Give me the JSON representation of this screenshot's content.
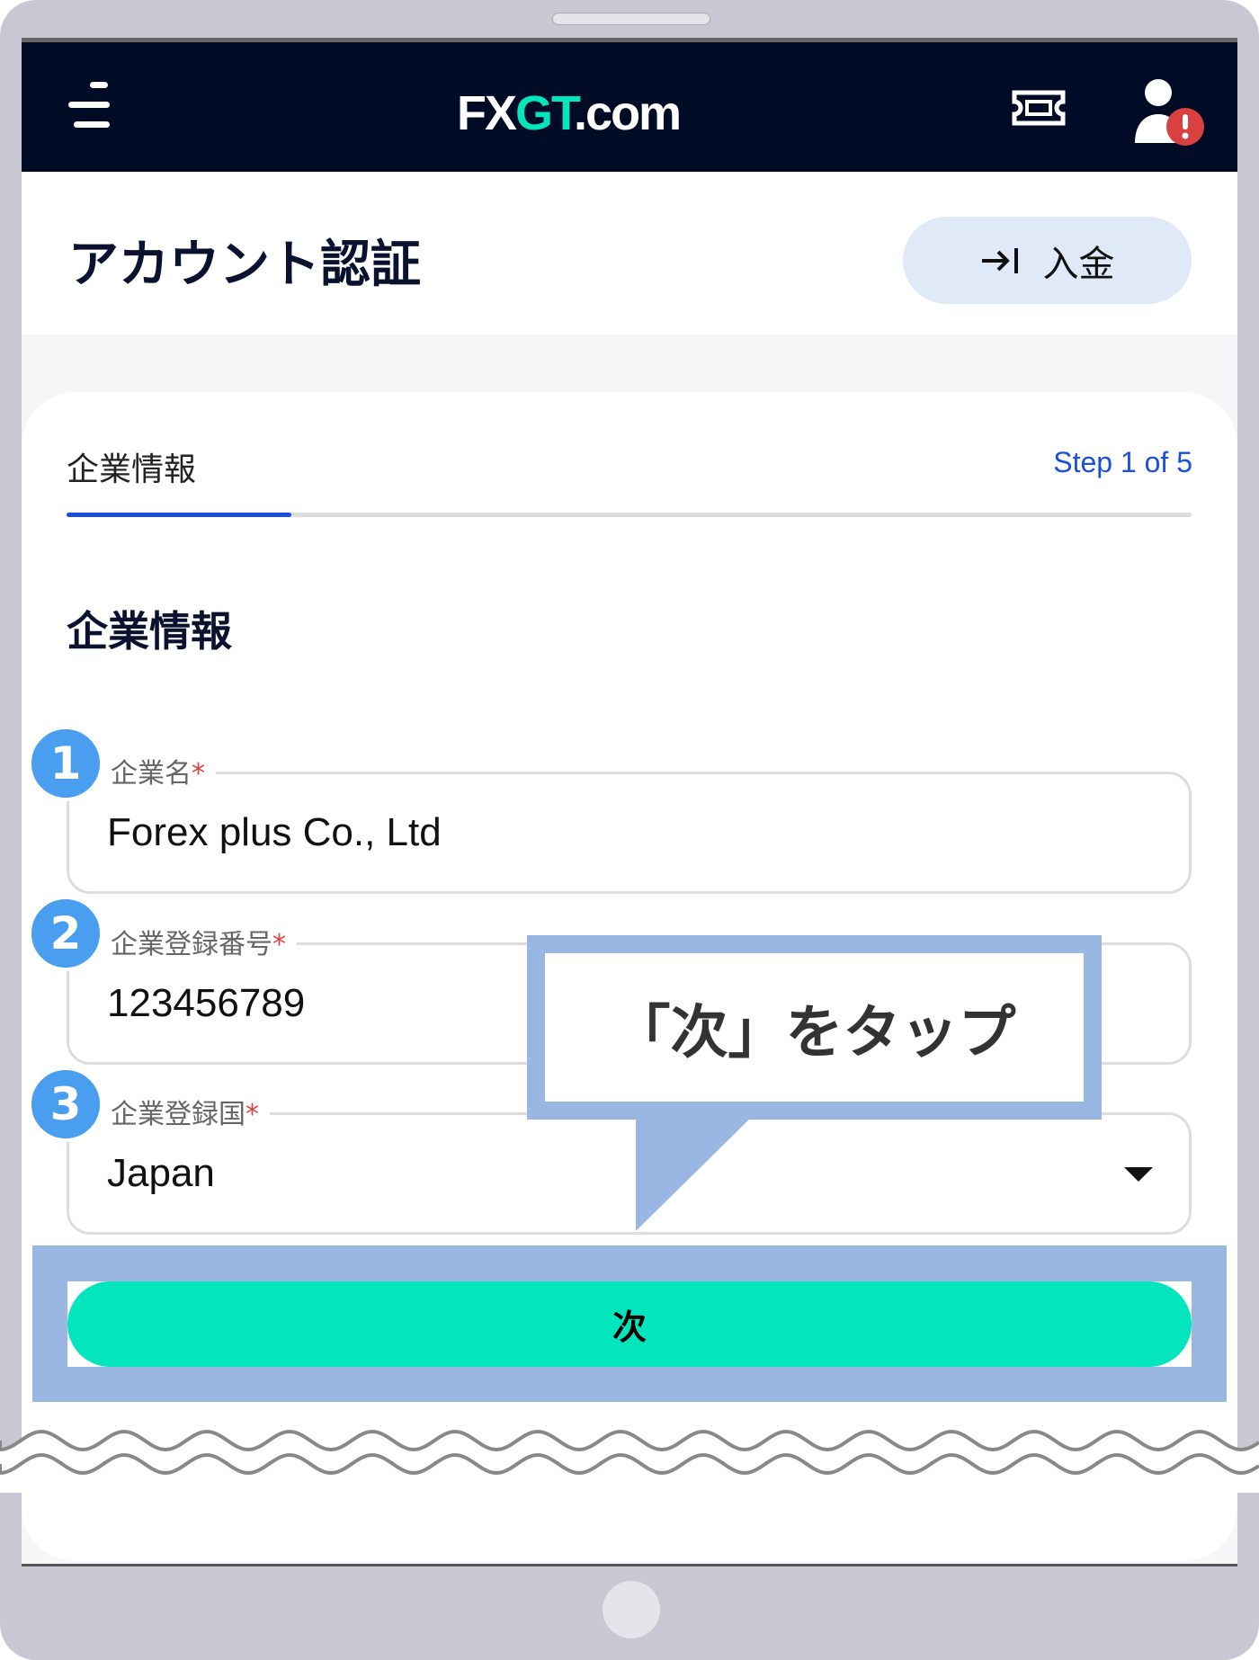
{
  "header": {
    "logo": {
      "part1": "FX",
      "part2": "GT",
      ".com": ".com"
    },
    "logo_text_a": "FX",
    "logo_text_b": "GT",
    "logo_text_c": ".com",
    "icons": [
      "menu-icon",
      "ticket-icon",
      "user-alert-icon"
    ]
  },
  "titlebar": {
    "title": "アカウント認証",
    "deposit_label": "入金",
    "deposit_icon": "arrow-to-bar-icon"
  },
  "wizard": {
    "tab_label": "企業情報",
    "step": "Step 1 of 5",
    "progress": 0.2,
    "section_heading": "企業情報"
  },
  "fields": [
    {
      "number": "1",
      "label": "企業名",
      "required": "*",
      "value": "Forex plus Co., Ltd"
    },
    {
      "number": "2",
      "label": "企業登録番号",
      "required": "*",
      "value": "123456789"
    },
    {
      "number": "3",
      "label": "企業登録国",
      "required": "*",
      "value": "Japan"
    }
  ],
  "next_button": "次",
  "callout": "「次」をタップ",
  "colors": {
    "header": "#000b26",
    "accent": "#03e5bd",
    "link": "#1a4fe0",
    "highlight": "#9ab6e3",
    "badge": "#4a9ef0"
  }
}
